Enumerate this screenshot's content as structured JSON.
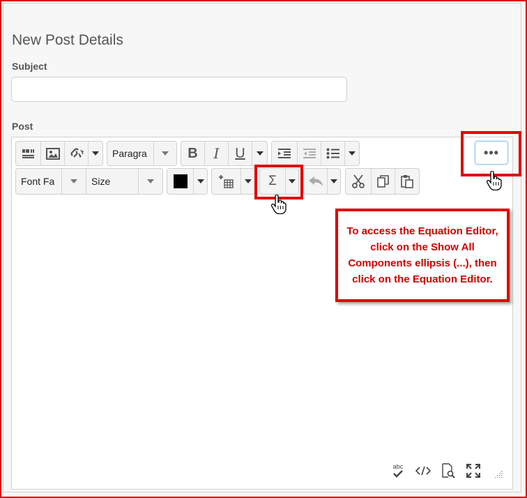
{
  "page": {
    "title": "New Post Details"
  },
  "form": {
    "subject_label": "Subject",
    "subject_value": "",
    "post_label": "Post"
  },
  "toolbar": {
    "paragraph_select": "Paragra",
    "font_family_select": "Font Fa",
    "size_select": "Size",
    "text_color": "#000000",
    "show_all_components": "•••",
    "icons": [
      "insert-stuff-icon",
      "insert-image-icon",
      "insert-link-icon",
      "paragraph-format-select",
      "bold-icon",
      "italic-icon",
      "underline-icon",
      "indent-icon",
      "outdent-icon",
      "bullet-list-icon",
      "text-color-icon",
      "insert-table-icon",
      "equation-editor-icon",
      "undo-icon",
      "cut-icon",
      "copy-icon",
      "paste-icon",
      "show-all-components-icon"
    ]
  },
  "statusbar": {
    "spellcheck_label": "abc",
    "icons": [
      "spellcheck-icon",
      "source-code-icon",
      "preview-icon",
      "fullscreen-icon",
      "resize-handle-icon"
    ]
  },
  "callout": {
    "text": "To access the Equation Editor, click on the Show All Components ellipsis (...), then click on the Equation Editor."
  },
  "colors": {
    "highlight": "#e00000",
    "callout_text": "#d00000"
  }
}
